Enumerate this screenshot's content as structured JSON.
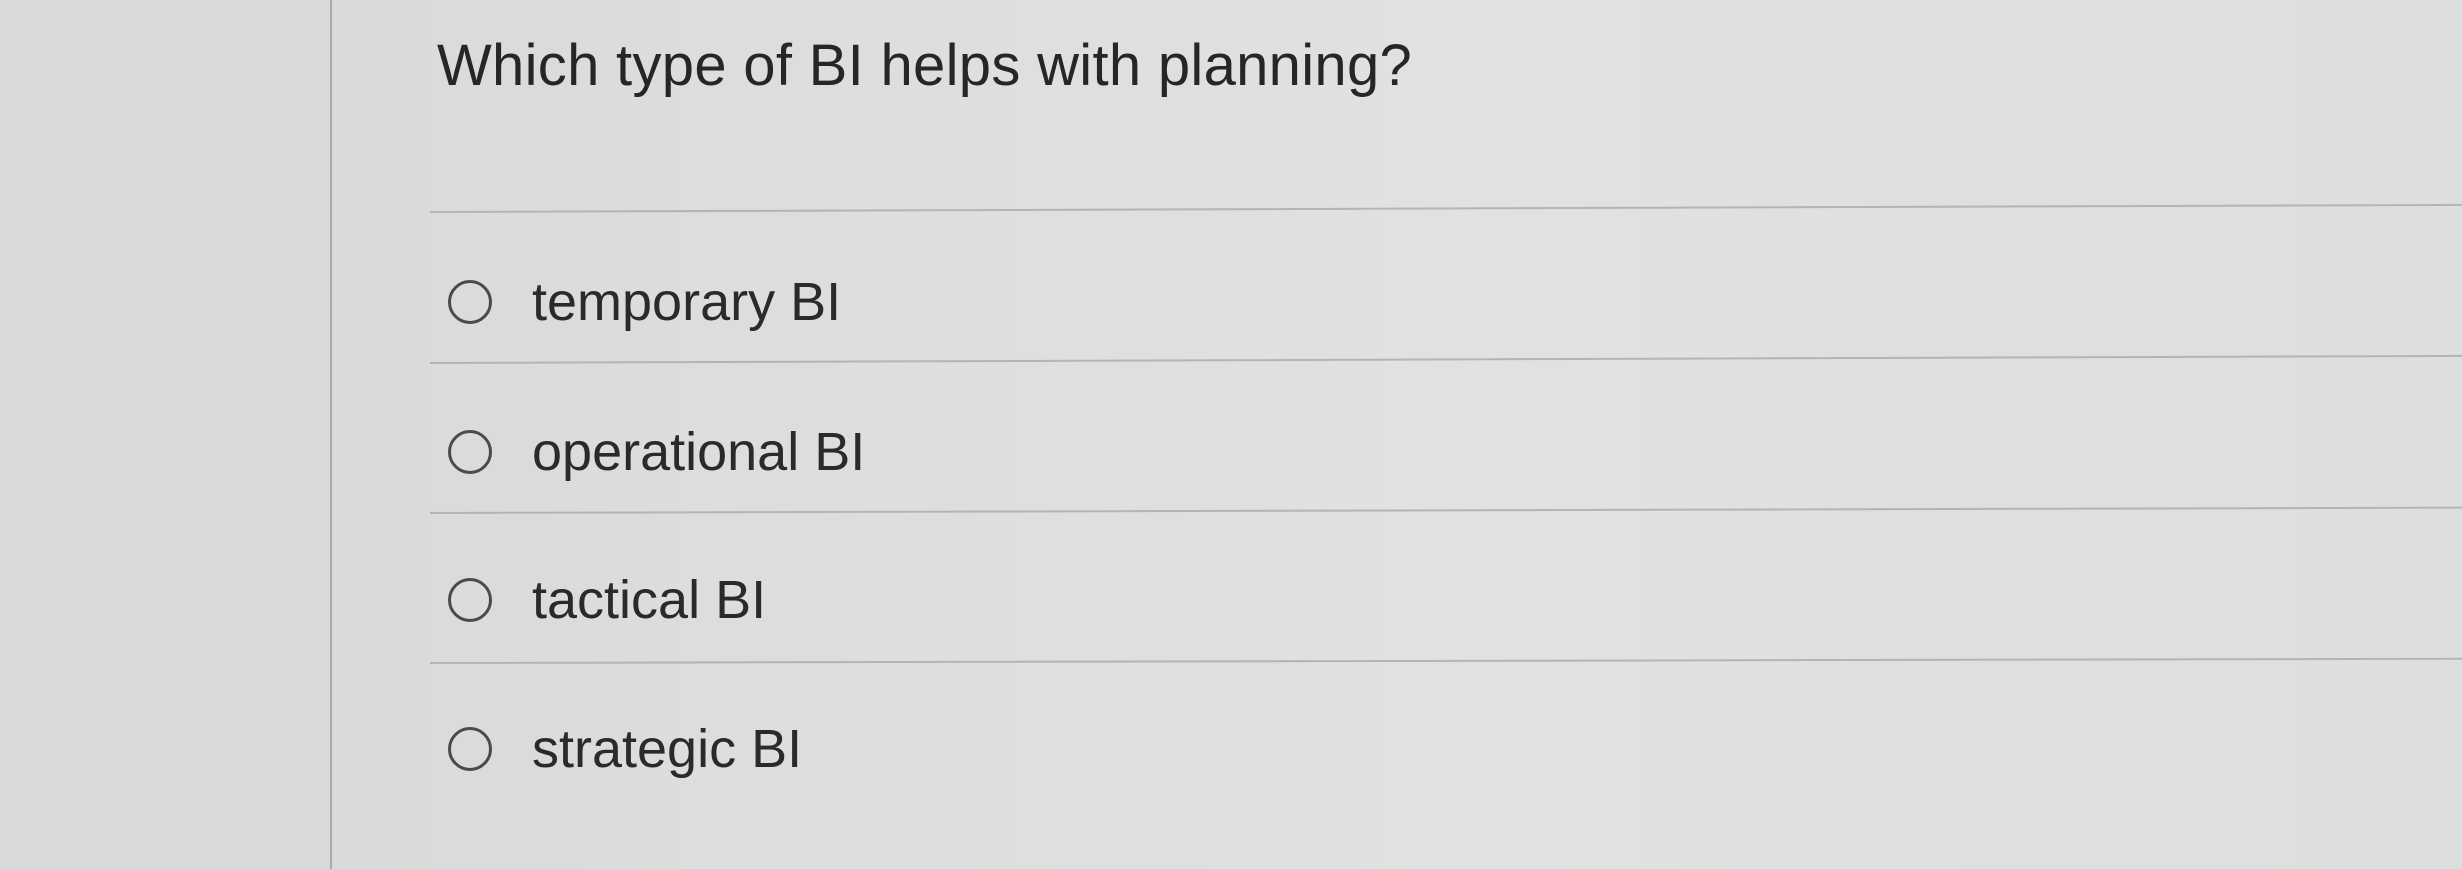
{
  "question": {
    "text": "Which type of BI helps with planning?"
  },
  "options": [
    {
      "label": "temporary BI",
      "selected": false
    },
    {
      "label": "operational BI",
      "selected": false
    },
    {
      "label": "tactical BI",
      "selected": false
    },
    {
      "label": "strategic BI",
      "selected": false
    }
  ]
}
